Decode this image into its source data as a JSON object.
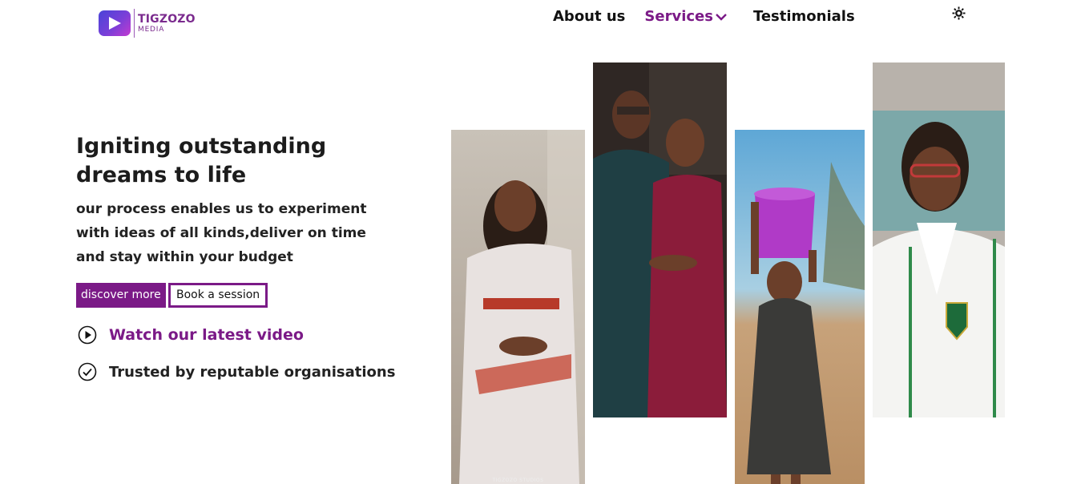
{
  "brand": {
    "name": "TIGZOZO",
    "sub": "MEDIA"
  },
  "nav": {
    "about": "About us",
    "services": "Services",
    "testimonials": "Testimonials"
  },
  "hero": {
    "title": "Igniting outstanding dreams to life",
    "subtitle": "our process enables us to experiment with ideas of all kinds,deliver on time and stay within your budget",
    "discover_label": "discover more",
    "book_label": "Book a session",
    "video_label": "Watch our latest video",
    "trust_label": "Trusted by reputable organisations"
  },
  "gallery": {
    "watermark": "TIGZOZO STUDIOS"
  },
  "colors": {
    "accent": "#7b1a87",
    "text": "#1c1c1c"
  },
  "icons": [
    "theme-toggle-icon",
    "play-circle-icon",
    "check-circle-icon",
    "chevron-down-icon"
  ]
}
